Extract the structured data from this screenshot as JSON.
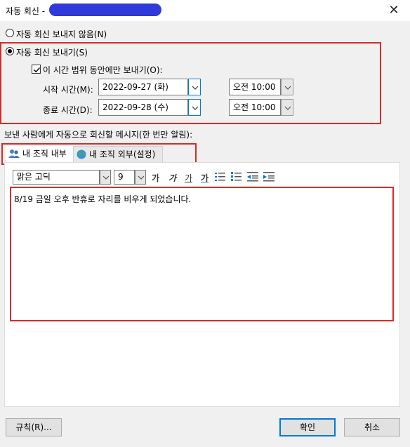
{
  "window": {
    "title": "자동 회신 -",
    "close": "✕"
  },
  "options": {
    "no_auto_reply": "자동 회신 보내지 않음(N)",
    "send_auto_reply": "자동 회신 보내기(S)",
    "only_time_range": "이 시간 범위 동안에만 보내기(O):"
  },
  "schedule": {
    "start_label": "시작 시간(M):",
    "start_date": "2022-09-27 (화)",
    "start_time": "오전 10:00",
    "end_label": "종료 시간(D):",
    "end_date": "2022-09-28 (수)",
    "end_time": "오전 10:00"
  },
  "message_label": "보낸 사람에게 자동으로 회신할 메시지(한 번만 알림):",
  "tabs": [
    {
      "label": "내 조직 내부",
      "icon": "people-icon"
    },
    {
      "label": "내 조직 외부(설정)",
      "icon": "globe-icon"
    }
  ],
  "toolbar": {
    "font": "맑은 고딕",
    "size": "9",
    "bold": "가",
    "italic": "가",
    "underline": "가",
    "font_color": "가"
  },
  "message_body": "8/19 금일 오후 반휴로 자리를 비우게 되었습니다.",
  "buttons": {
    "rules": "규칙(R)...",
    "ok": "확인",
    "cancel": "취소"
  },
  "colors": {
    "highlight_red": "#d62a2a",
    "accent_blue": "#0078d7",
    "redaction_blue": "#2f3ad8"
  }
}
